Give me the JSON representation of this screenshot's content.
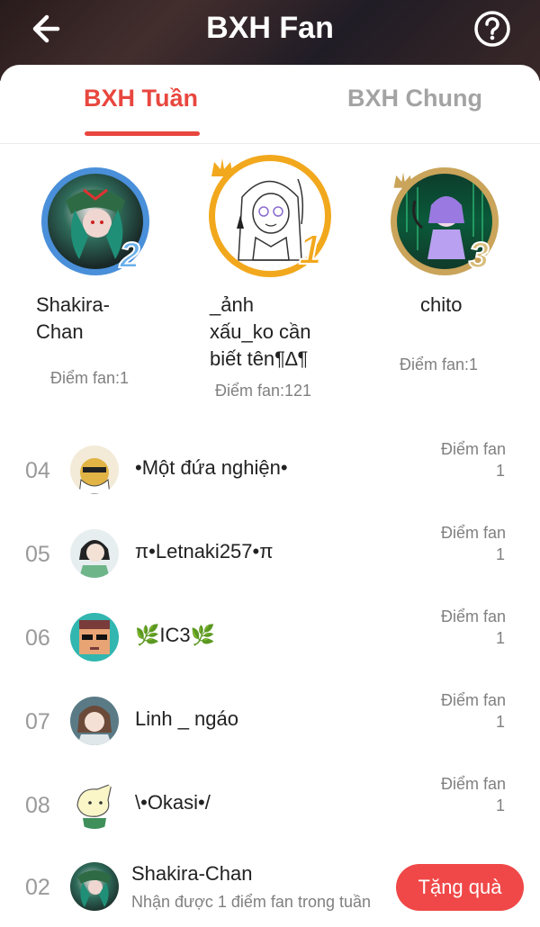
{
  "header": {
    "title": "BXH Fan",
    "back_icon": "arrow-left-icon",
    "help_icon": "question-circle-icon"
  },
  "tabs": [
    {
      "label": "BXH Tuần",
      "active": true
    },
    {
      "label": "BXH Chung",
      "active": false
    }
  ],
  "podium": [
    {
      "rank": "2",
      "name": "Shakira-Chan",
      "name_lines": [
        "Shakira-",
        "Chan"
      ],
      "score": "Điểm fan:1",
      "ring_color": "#4a8fd9"
    },
    {
      "rank": "1",
      "name": "_ảnh xấu_ko cần biết tên¶∆¶",
      "name_lines": [
        "_ảnh",
        "xấu_ko cần",
        "biết tên¶∆¶"
      ],
      "score": "Điểm fan:121",
      "ring_color": "#f2a81d"
    },
    {
      "rank": "3",
      "name": "chito",
      "name_lines": [
        "chito"
      ],
      "score": "Điểm fan:1",
      "ring_color": "#c9a45a"
    }
  ],
  "list": [
    {
      "rank": "04",
      "name": "•Một đứa nghiện•",
      "score_label": "Điểm fan",
      "score": "1"
    },
    {
      "rank": "05",
      "name": "π•Letnaki257•π",
      "score_label": "Điểm fan",
      "score": "1"
    },
    {
      "rank": "06",
      "name": "🌿IC3🌿",
      "score_label": "Điểm fan",
      "score": "1"
    },
    {
      "rank": "07",
      "name": "Linh _ ngáo",
      "score_label": "Điểm fan",
      "score": "1"
    },
    {
      "rank": "08",
      "name": "\\•Okasi•/",
      "score_label": "Điểm fan",
      "score": "1"
    }
  ],
  "me": {
    "rank": "02",
    "name": "Shakira-Chan",
    "subtitle": "Nhận được 1 điểm fan trong tuần",
    "gift_button": "Tặng quà"
  },
  "colors": {
    "accent": "#e8473f",
    "gift_button": "#f04848",
    "muted_text": "#808080"
  }
}
